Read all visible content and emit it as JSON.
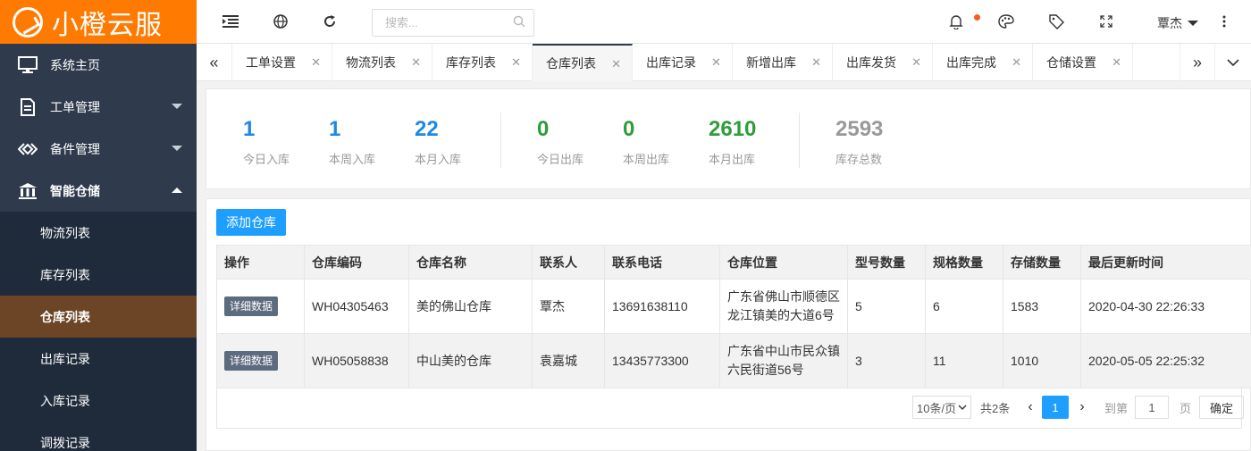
{
  "app": {
    "title": "小橙云服"
  },
  "sidebar": {
    "items": [
      {
        "label": "系统主页"
      },
      {
        "label": "工单管理"
      },
      {
        "label": "备件管理"
      },
      {
        "label": "智能仓储"
      }
    ],
    "sub_items": [
      {
        "label": "物流列表"
      },
      {
        "label": "库存列表"
      },
      {
        "label": "仓库列表",
        "active": true
      },
      {
        "label": "出库记录"
      },
      {
        "label": "入库记录"
      },
      {
        "label": "调拨记录"
      }
    ]
  },
  "header": {
    "search_placeholder": "搜索...",
    "user_name": "覃杰"
  },
  "tabs": [
    {
      "label": "工单设置"
    },
    {
      "label": "物流列表"
    },
    {
      "label": "库存列表"
    },
    {
      "label": "仓库列表",
      "active": true
    },
    {
      "label": "出库记录"
    },
    {
      "label": "新增出库"
    },
    {
      "label": "出库发货"
    },
    {
      "label": "出库完成"
    },
    {
      "label": "仓储设置"
    }
  ],
  "stats": [
    {
      "value": "1",
      "label": "今日入库",
      "color": "#1e88e5"
    },
    {
      "value": "1",
      "label": "本周入库",
      "color": "#1e88e5"
    },
    {
      "value": "22",
      "label": "本月入库",
      "color": "#1e88e5"
    },
    {
      "value": "0",
      "label": "今日出库",
      "color": "#2e9d3a"
    },
    {
      "value": "0",
      "label": "本周出库",
      "color": "#2e9d3a"
    },
    {
      "value": "2610",
      "label": "本月出库",
      "color": "#2e9d3a"
    },
    {
      "value": "2593",
      "label": "库存总数",
      "color": "#999999"
    }
  ],
  "add_button_label": "添加仓库",
  "table": {
    "columns": [
      "操作",
      "仓库编码",
      "仓库名称",
      "联系人",
      "联系电话",
      "仓库位置",
      "型号数量",
      "规格数量",
      "存储数量",
      "最后更新时间"
    ],
    "rows": [
      {
        "action": "详细数据",
        "code": "WH04305463",
        "name": "美的佛山仓库",
        "contact": "覃杰",
        "phone": "13691638110",
        "location_line1": "广东省佛山市顺德区",
        "location_line2": "龙江镇美的大道6号",
        "model_count": "5",
        "spec_count": "6",
        "storage_count": "1583",
        "updated": "2020-04-30 22:26:33"
      },
      {
        "action": "详细数据",
        "code": "WH05058838",
        "name": "中山美的仓库",
        "contact": "袁嘉城",
        "phone": "13435773300",
        "location_line1": "广东省中山市民众镇",
        "location_line2": "六民街道56号",
        "model_count": "3",
        "spec_count": "11",
        "storage_count": "1010",
        "updated": "2020-05-05 22:25:32"
      }
    ]
  },
  "pagination": {
    "page_size": "10条/页",
    "total": "共2条",
    "current_page": "1",
    "goto_label": "到第",
    "goto_value": "1",
    "page_unit": "页",
    "confirm": "确定"
  },
  "colors": {
    "brand": "#ff7a00",
    "sidebar_bg": "#2f3a4c",
    "active_sub": "#6b4526",
    "primary": "#1e9fff"
  }
}
